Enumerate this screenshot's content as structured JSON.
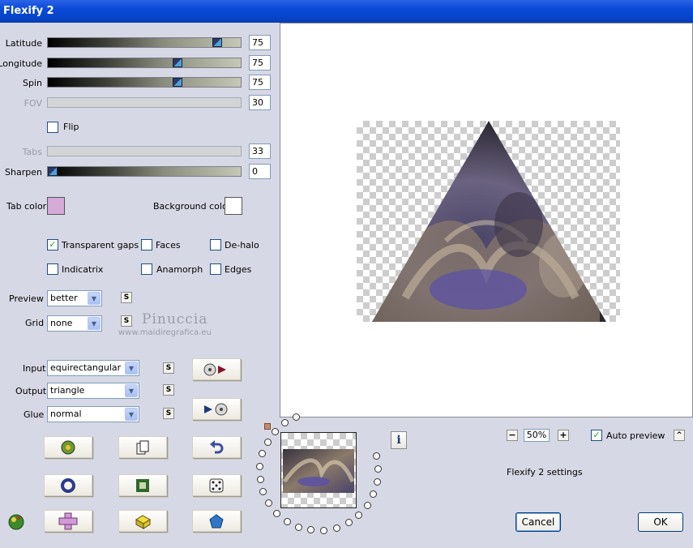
{
  "window": {
    "title": "Flexify 2"
  },
  "sliders": [
    {
      "label": "Latitude",
      "value": "75",
      "level": 0.9,
      "enabled": true
    },
    {
      "label": "Longitude",
      "value": "75",
      "level": 0.68,
      "enabled": true
    },
    {
      "label": "Spin",
      "value": "75",
      "level": 0.68,
      "enabled": true
    },
    {
      "label": "FOV",
      "value": "30",
      "level": 0.3,
      "enabled": false
    },
    {
      "label": "Tabs",
      "value": "33",
      "level": 0.33,
      "enabled": false
    },
    {
      "label": "Sharpen",
      "value": "0",
      "level": 0.0,
      "enabled": true
    }
  ],
  "flip": {
    "label": "Flip",
    "checked": false
  },
  "colors": {
    "tab_label": "Tab color",
    "tab_color": "#d5a9d8",
    "bg_label": "Background color",
    "bg_color": "#ffffff"
  },
  "options": {
    "transparent_gaps": {
      "label": "Transparent gaps",
      "checked": true
    },
    "faces": {
      "label": "Faces",
      "checked": false
    },
    "dehalo": {
      "label": "De-halo",
      "checked": false
    },
    "indicatrix": {
      "label": "Indicatrix",
      "checked": false
    },
    "anamorph": {
      "label": "Anamorph",
      "checked": false
    },
    "edges": {
      "label": "Edges",
      "checked": false
    }
  },
  "preview_select": {
    "label": "Preview",
    "value": "better"
  },
  "grid_select": {
    "label": "Grid",
    "value": "none"
  },
  "watermark": {
    "name": "Pinuccia",
    "url": "www.maidiregrafica.eu"
  },
  "input_select": {
    "label": "Input",
    "value": "equirectangular"
  },
  "output_select": {
    "label": "Output",
    "value": "triangle"
  },
  "glue_select": {
    "label": "Glue",
    "value": "normal"
  },
  "s_button_label": "S",
  "zoom": {
    "value": "50%",
    "minus": "−",
    "plus": "+"
  },
  "auto_preview": {
    "label": "Auto preview",
    "checked": true
  },
  "collapse_label": "^",
  "settings_label": "Flexify 2 settings",
  "buttons": {
    "cancel": "Cancel",
    "ok": "OK"
  },
  "info_label": "i"
}
